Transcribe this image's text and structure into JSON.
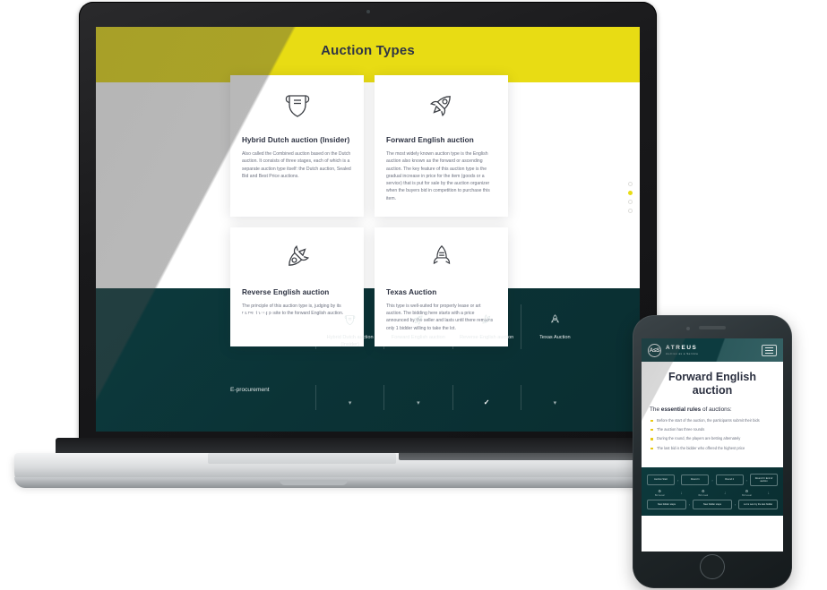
{
  "device_mockup": {
    "laptop_label": "laptop-device-mockup",
    "phone_label": "phone-device-mockup"
  },
  "desktop": {
    "page_title": "Auction Types",
    "cards": [
      {
        "icon": "shield-badge-icon",
        "title": "Hybrid Dutch auction (Insider)",
        "text": "Also called the Combined auction based on the Dutch auction. It consists of three stages, each of which is a separate auction type itself: the Dutch auction, Sealed Bid and Best Price auctions."
      },
      {
        "icon": "rocket-icon",
        "title": "Forward English auction",
        "text": "The most widely known auction type is the English auction also known as the forward or ascending auction. The key feature of this auction type is the gradual increase in price for the item (goods or a service) that is put for sale by the auction organizer when the buyers bid in competition to purchase this item."
      },
      {
        "icon": "rocket-reverse-icon",
        "title": "Reverse English auction",
        "text": "The principle of this auction type is, judging by its name, the opposite to the forward English auction."
      },
      {
        "icon": "rocket-up-icon",
        "title": "Texas Auction",
        "text": "This type is well-suited for property lease or art auction. The bidding here starts with a price announced by the seller and lasts until there remains only 1 bidder willing to take the lot."
      }
    ],
    "comparison": {
      "heading": "Auction strategies",
      "columns": [
        {
          "icon": "shield-badge-icon",
          "label": "Hybrid Dutch auction (Insider)"
        },
        {
          "icon": "rocket-icon",
          "label": "Forward English auction"
        },
        {
          "icon": "rocket-reverse-icon",
          "label": "Reverse English auction"
        },
        {
          "icon": "rocket-up-icon",
          "label": "Texas Auction"
        }
      ],
      "rows": [
        {
          "label": "E-procurement",
          "cells": [
            "chevron-down",
            "chevron-down",
            "check",
            "chevron-down"
          ]
        }
      ]
    },
    "dot_nav": {
      "count": 4,
      "active_index": 1
    }
  },
  "mobile": {
    "brand": {
      "mark": "A≤S",
      "name": "ATREUS",
      "tagline": "Auction as a Service"
    },
    "menu_icon": "hamburger-menu-icon",
    "heading": "Forward English auction",
    "subheading_prefix": "The ",
    "subheading_bold": "essential rules",
    "subheading_suffix": " of auctions:",
    "rules": [
      "Before the start of the auction, the participants submit their bids",
      "The auction has three rounds",
      "During the round, the players are betting alternately",
      "The last bid is the bidder who offered the highest price"
    ],
    "flow": {
      "top_boxes": [
        "Auction Start",
        "Round 1",
        "Round 2",
        "Round 3 / End of auction"
      ],
      "mid_labels": [
        "Bid reveal",
        "Bid reveal",
        "Bid reveal"
      ],
      "bottom_boxes": [
        "New bidder steps",
        "New bidder steps",
        "Lot is won by the last bidder"
      ]
    }
  },
  "colors": {
    "yellow": "#e8dc14",
    "teal": "#0c3a3d",
    "ink": "#2b3040",
    "muted": "#6d7280",
    "bezel": "#19191b",
    "silver": "#dadcde"
  }
}
